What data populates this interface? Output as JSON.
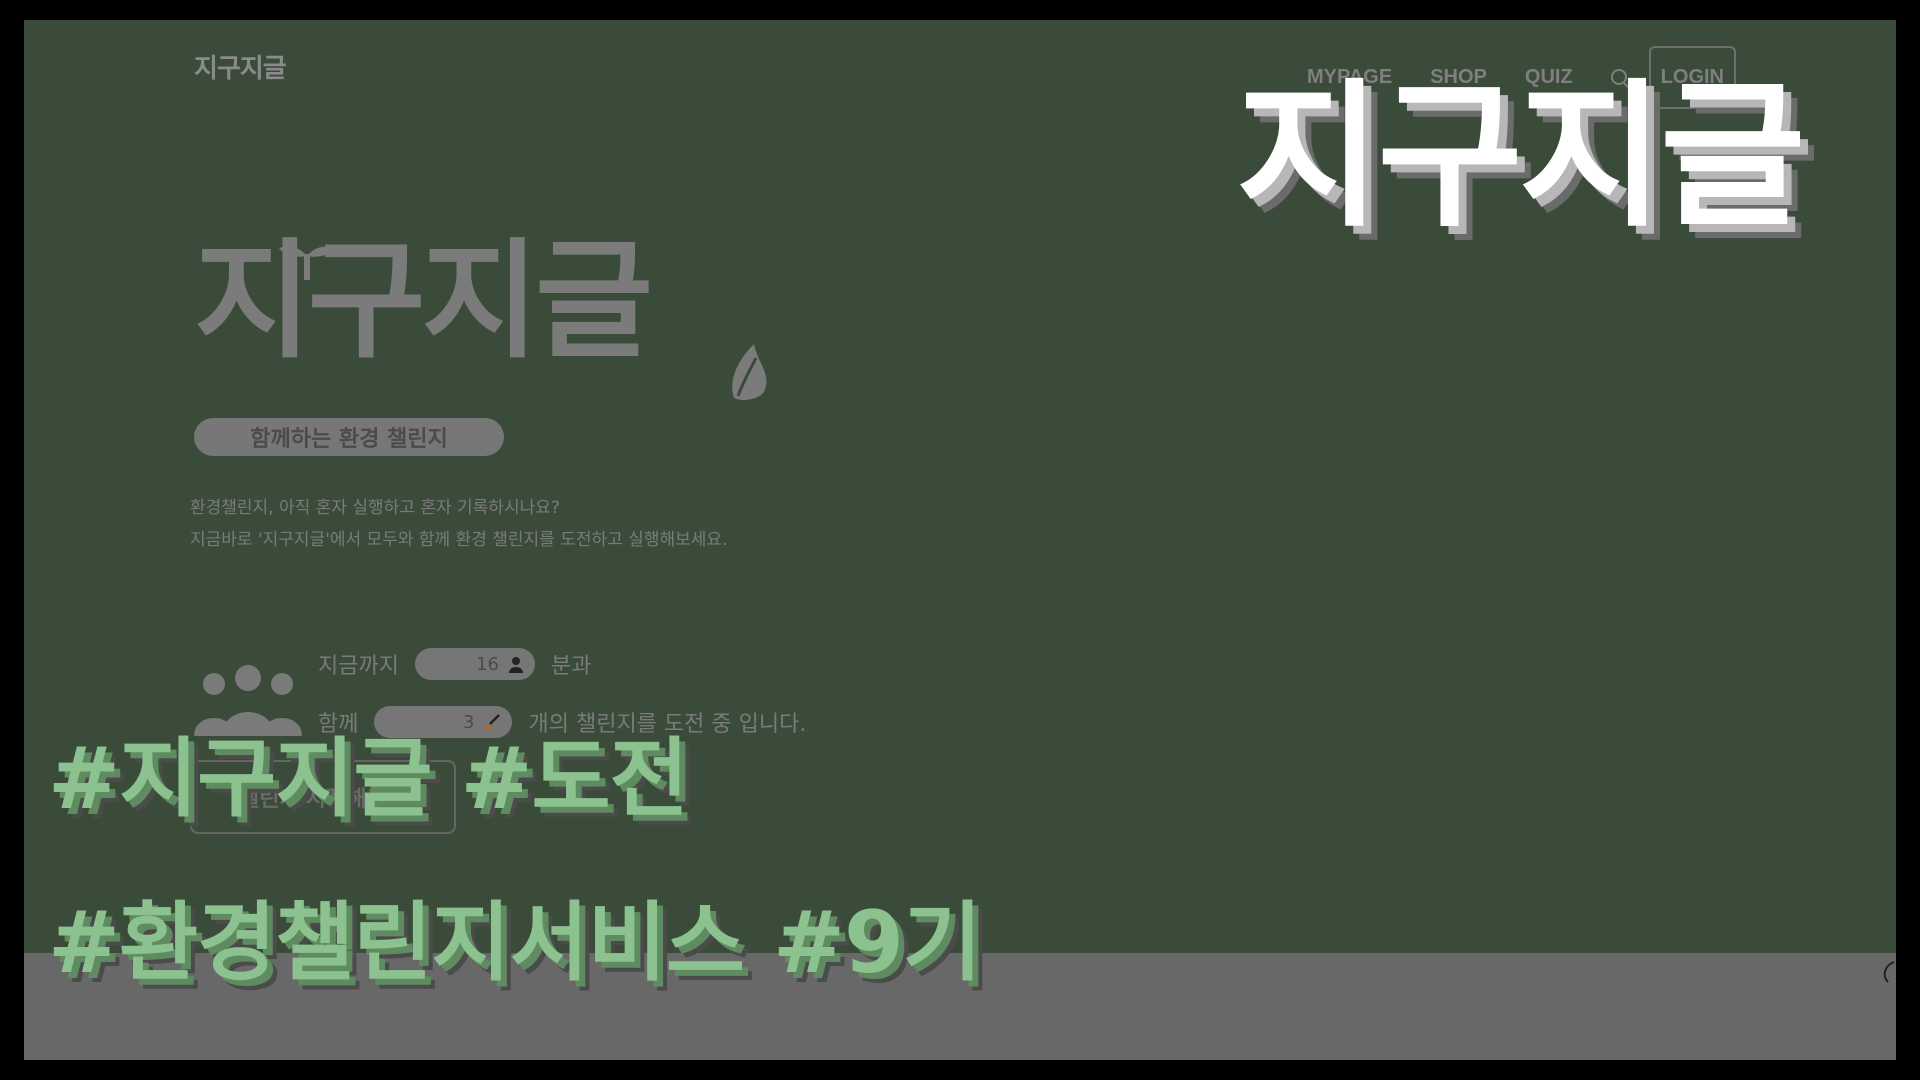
{
  "nav": {
    "logo": "지구지글",
    "items": [
      "MYPAGE",
      "SHOP",
      "QUIZ"
    ],
    "login_label": "LOGIN"
  },
  "hero": {
    "title": "지구지글",
    "subtitle": "함께하는 환경 챌린지",
    "desc_line1": "환경챌린지, 아직 혼자 실행하고 혼자 기록하시나요?",
    "desc_line2": "지금바로 '지구지글'에서 모두와 함께 환경 챌린지를 도전하고 실행해보세요."
  },
  "stats": {
    "row1_prefix": "지금까지",
    "row1_value": "16",
    "row1_suffix": "분과",
    "row2_prefix": "함께",
    "row2_value": "3",
    "row2_suffix": "개의 챌린지를 도전 중 입니다."
  },
  "start_button_label": "챌린지 시작해보기",
  "overlay": {
    "title": "지구지글",
    "hashtag_line1": "#지구지글 #도전",
    "hashtag_line2": "#환경챌린지서비스 #9기"
  },
  "colors": {
    "background": "#3a4c39",
    "hashtag": "#8bc28f",
    "band": "#686868"
  }
}
